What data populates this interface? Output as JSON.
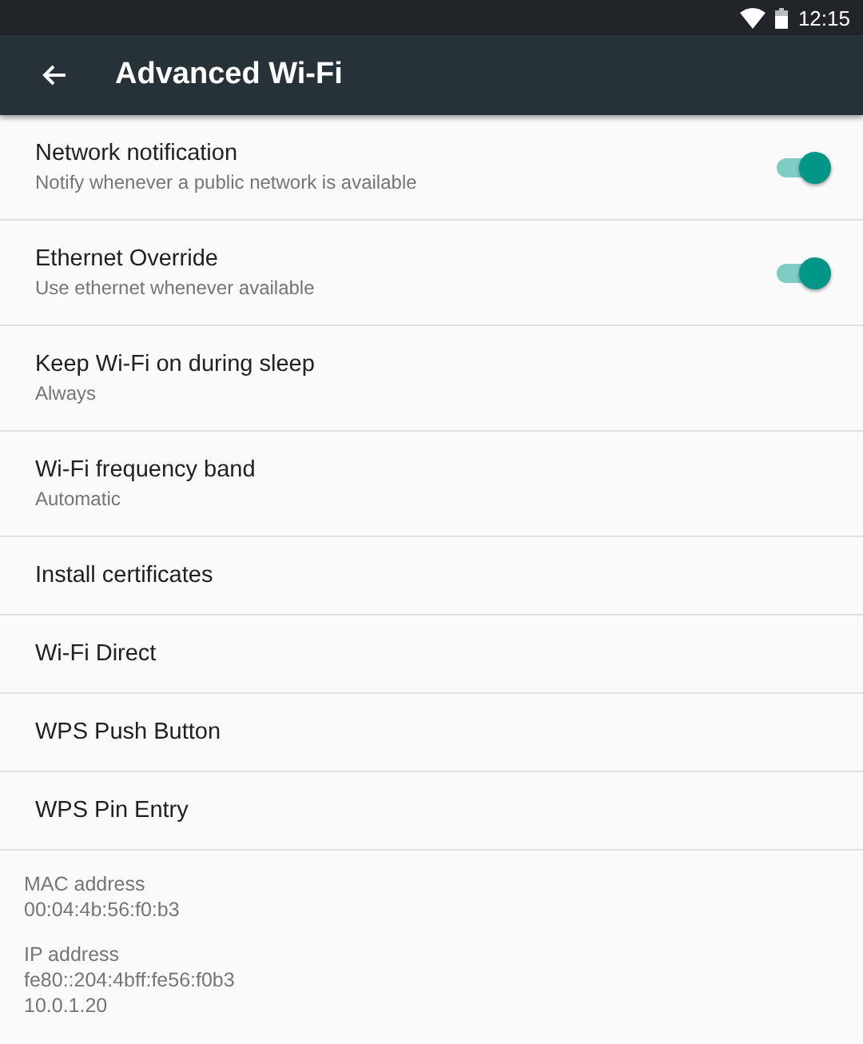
{
  "status_bar": {
    "time": "12:15"
  },
  "app_bar": {
    "title": "Advanced Wi-Fi"
  },
  "settings": [
    {
      "kind": "switch",
      "title": "Network notification",
      "summary": "Notify whenever a public network is available",
      "on": true
    },
    {
      "kind": "switch",
      "title": "Ethernet Override",
      "summary": "Use ethernet whenever available",
      "on": true
    },
    {
      "kind": "plain",
      "title": "Keep Wi-Fi on during sleep",
      "summary": "Always"
    },
    {
      "kind": "plain",
      "title": "Wi-Fi frequency band",
      "summary": "Automatic"
    },
    {
      "kind": "plain",
      "title": "Install certificates"
    },
    {
      "kind": "plain",
      "title": "Wi-Fi Direct"
    },
    {
      "kind": "plain",
      "title": "WPS Push Button"
    },
    {
      "kind": "plain",
      "title": "WPS Pin Entry"
    }
  ],
  "info": [
    {
      "label": "MAC address",
      "values": [
        "00:04:4b:56:f0:b3"
      ]
    },
    {
      "label": "IP address",
      "values": [
        "fe80::204:4bff:fe56:f0b3",
        "10.0.1.20"
      ]
    }
  ]
}
